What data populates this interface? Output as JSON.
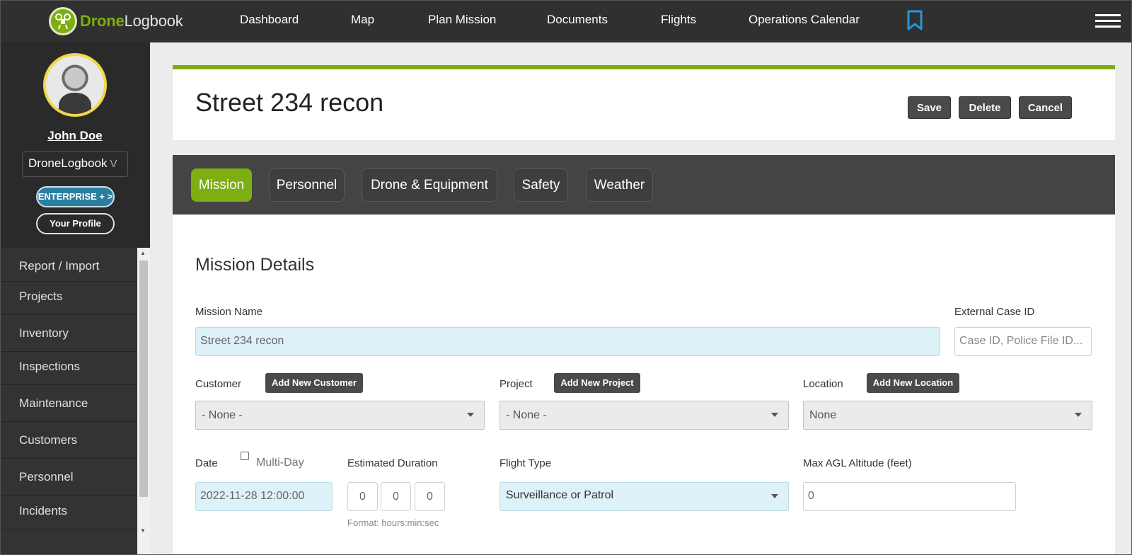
{
  "app": {
    "logo_brand": "Drone",
    "logo_rest": "Logbook"
  },
  "nav": {
    "links": [
      "Dashboard",
      "Map",
      "Plan Mission",
      "Documents",
      "Flights",
      "Operations Calendar"
    ],
    "bookmark_icon": "bookmark-icon",
    "menu_icon": "hamburger-menu-icon"
  },
  "sidebar": {
    "user_name": "John Doe",
    "org": "DroneLogbook",
    "enterprise_label": "ENTERPRISE + >",
    "profile_label": "Your Profile",
    "items": [
      "Report / Import",
      "Projects",
      "Inventory",
      "Inspections",
      "Maintenance",
      "Customers",
      "Personnel",
      "Incidents"
    ]
  },
  "header": {
    "title": "Street 234 recon",
    "save_label": "Save",
    "delete_label": "Delete",
    "cancel_label": "Cancel"
  },
  "tabs": [
    "Mission",
    "Personnel",
    "Drone & Equipment",
    "Safety",
    "Weather"
  ],
  "form": {
    "section_title": "Mission Details",
    "mission_name_label": "Mission Name",
    "mission_name_value": "Street 234 recon",
    "external_case_label": "External Case ID",
    "external_case_placeholder": "Case ID, Police File ID...",
    "customer_label": "Customer",
    "add_customer_label": "Add New Customer",
    "customer_value": "- None -",
    "project_label": "Project",
    "add_project_label": "Add New Project",
    "project_value": "- None -",
    "location_label": "Location",
    "add_location_label": "Add New Location",
    "location_value": "None",
    "date_label": "Date",
    "multi_day_label": "Multi-Day",
    "date_value": "2022-11-28 12:00:00",
    "duration_label": "Estimated Duration",
    "duration_hours": "0",
    "duration_minutes": "0",
    "duration_seconds": "0",
    "duration_hint": "Format: hours:min:sec",
    "flight_type_label": "Flight Type",
    "flight_type_value": "Surveillance or Patrol",
    "altitude_label": "Max AGL Altitude (feet)",
    "altitude_value": "0"
  },
  "colors": {
    "accent_green": "#7dae12",
    "nav_bg": "#303030",
    "enterprise_blue": "#2a7fa0",
    "bookmark_blue": "#1e9bd7"
  }
}
